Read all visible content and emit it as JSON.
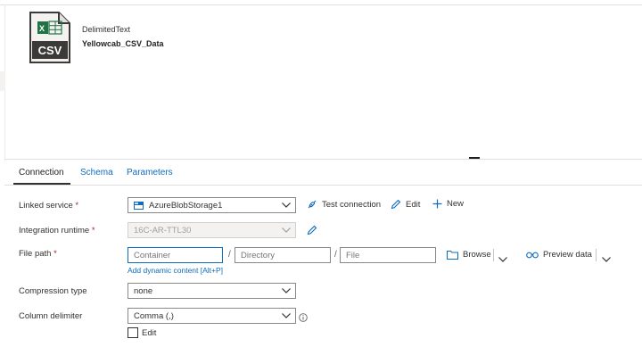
{
  "dataset": {
    "type": "DelimitedText",
    "name": "Yellowcab_CSV_Data",
    "icon_badge": "CSV"
  },
  "tabs": [
    {
      "label": "Connection",
      "active": true
    },
    {
      "label": "Schema",
      "active": false
    },
    {
      "label": "Parameters",
      "active": false
    }
  ],
  "linked_service": {
    "label": "Linked service",
    "required": "*",
    "value": "AzureBlobStorage1",
    "test_connection": "Test connection",
    "edit": "Edit",
    "new": "New"
  },
  "integration_runtime": {
    "label": "Integration runtime",
    "required": "*",
    "value": "16C-AR-TTL30"
  },
  "file_path": {
    "label": "File path",
    "required": "*",
    "container_placeholder": "Container",
    "directory_placeholder": "Directory",
    "file_placeholder": "File",
    "separator": "/",
    "browse": "Browse",
    "preview": "Preview data",
    "dynamic_content": "Add dynamic content [Alt+P]"
  },
  "compression_type": {
    "label": "Compression type",
    "value": "none"
  },
  "column_delimiter": {
    "label": "Column delimiter",
    "value": "Comma (,)",
    "edit_label": "Edit"
  },
  "colors": {
    "accent": "#0f6cbd",
    "required": "#a4262c",
    "excel_green": "#217346"
  }
}
